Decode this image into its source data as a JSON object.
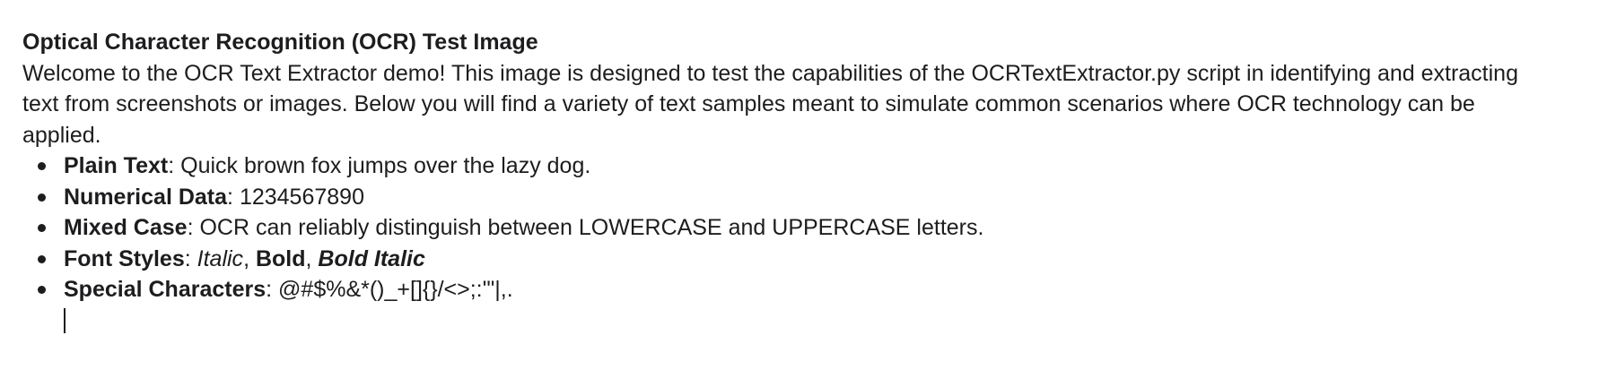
{
  "document": {
    "title": "Optical Character Recognition (OCR) Test Image",
    "intro": "Welcome to the OCR Text Extractor demo! This image is designed to test the capabilities of the OCRTextExtractor.py script in identifying and extracting text from screenshots or images. Below you will find a variety of text samples meant to simulate common scenarios where OCR technology can be applied.",
    "items": [
      {
        "label": "Plain Text",
        "sep": ": ",
        "value": "Quick brown fox jumps over the lazy dog."
      },
      {
        "label": "Numerical Data",
        "sep": ": ",
        "value": "1234567890"
      },
      {
        "label": "Mixed Case",
        "sep": ": ",
        "value": "OCR can reliably distinguish between LOWERCASE and UPPERCASE letters."
      },
      {
        "label": "Font Styles",
        "sep": ": ",
        "italic": "Italic",
        "comma1": ", ",
        "bold": "Bold",
        "comma2": ", ",
        "bold_italic": "Bold Italic"
      },
      {
        "label": "Special Characters",
        "sep": ": ",
        "value": "@#$%&*()_+[]{}/<>;:'\"|,."
      }
    ]
  }
}
